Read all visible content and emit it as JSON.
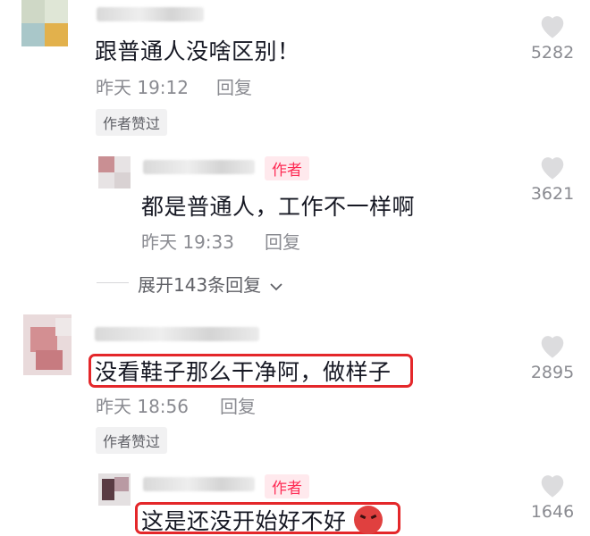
{
  "comments": [
    {
      "text": "跟普通人没啥区别！",
      "time": "昨天 19:12",
      "reply_label": "回复",
      "liked_badge": "作者赞过",
      "likes": "5282"
    },
    {
      "author_tag": "作者",
      "text": "都是普通人，工作不一样啊",
      "time": "昨天 19:33",
      "reply_label": "回复",
      "likes": "3621"
    },
    {
      "expand_label": "展开143条回复"
    },
    {
      "text": "没看鞋子那么干净阿，做样子",
      "time": "昨天 18:56",
      "reply_label": "回复",
      "liked_badge": "作者赞过",
      "likes": "2895"
    },
    {
      "author_tag": "作者",
      "text": "这是还没开始好不好",
      "likes": "1646"
    }
  ],
  "colors": {
    "author_red": "#fe2c55",
    "highlight_red": "#e4272a",
    "muted": "#8a8b91"
  },
  "icons": [
    "heart-icon",
    "chevron-down-icon",
    "angry-emoji-icon"
  ]
}
